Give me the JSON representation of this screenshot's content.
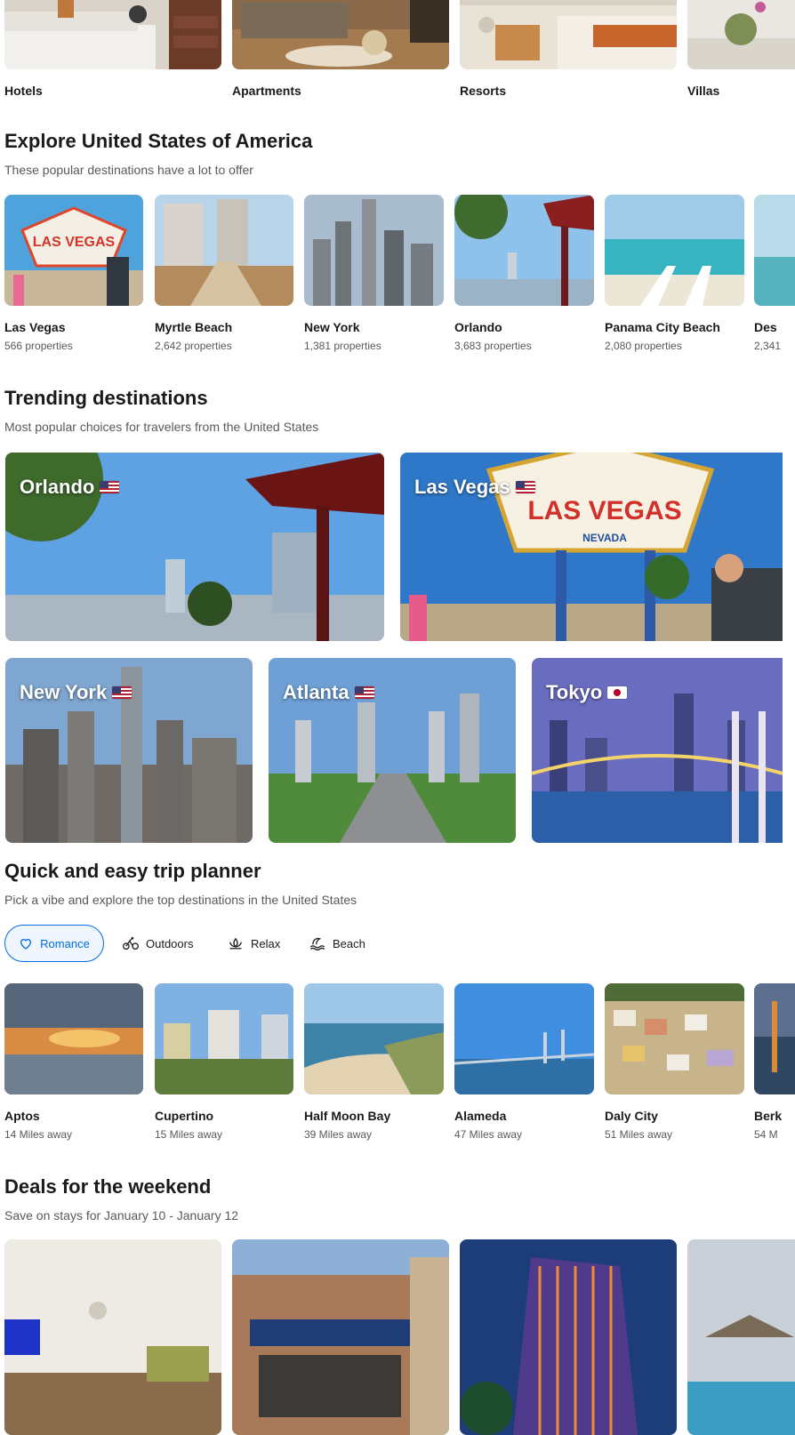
{
  "property_types": [
    {
      "label": "Hotels"
    },
    {
      "label": "Apartments"
    },
    {
      "label": "Resorts"
    },
    {
      "label": "Villas"
    }
  ],
  "explore": {
    "title": "Explore United States of America",
    "subtitle": "These popular destinations have a lot to offer",
    "cards": [
      {
        "name": "Las Vegas",
        "meta": "566 properties"
      },
      {
        "name": "Myrtle Beach",
        "meta": "2,642 properties"
      },
      {
        "name": "New York",
        "meta": "1,381 properties"
      },
      {
        "name": "Orlando",
        "meta": "3,683 properties"
      },
      {
        "name": "Panama City Beach",
        "meta": "2,080 properties"
      },
      {
        "name": "Des",
        "meta": "2,341"
      }
    ]
  },
  "trending": {
    "title": "Trending destinations",
    "subtitle": "Most popular choices for travelers from the United States",
    "cards": [
      {
        "name": "Orlando",
        "flag": "us-flag-icon"
      },
      {
        "name": "Las Vegas",
        "flag": "us-flag-icon"
      },
      {
        "name": "New York",
        "flag": "us-flag-icon"
      },
      {
        "name": "Atlanta",
        "flag": "us-flag-icon"
      },
      {
        "name": "Tokyo",
        "flag": "japan-flag-icon"
      }
    ]
  },
  "planner": {
    "title": "Quick and easy trip planner",
    "subtitle": "Pick a vibe and explore the top destinations in the United States",
    "chips": [
      {
        "label": "Romance",
        "icon": "heart-icon",
        "selected": true
      },
      {
        "label": "Outdoors",
        "icon": "bicycle-icon",
        "selected": false
      },
      {
        "label": "Relax",
        "icon": "lotus-icon",
        "selected": false
      },
      {
        "label": "Beach",
        "icon": "beach-wave-icon",
        "selected": false
      }
    ],
    "cards": [
      {
        "name": "Aptos",
        "meta": "14 Miles away"
      },
      {
        "name": "Cupertino",
        "meta": "15 Miles away"
      },
      {
        "name": "Half Moon Bay",
        "meta": "39 Miles away"
      },
      {
        "name": "Alameda",
        "meta": "47 Miles away"
      },
      {
        "name": "Daly City",
        "meta": "51 Miles away"
      },
      {
        "name": "Berk",
        "meta": "54 M"
      }
    ]
  },
  "deals": {
    "title": "Deals for the weekend",
    "subtitle": "Save on stays for January 10 - January 12"
  },
  "colors": {
    "accent": "#006ce4",
    "text": "#1a1a1a",
    "muted": "#595959"
  }
}
